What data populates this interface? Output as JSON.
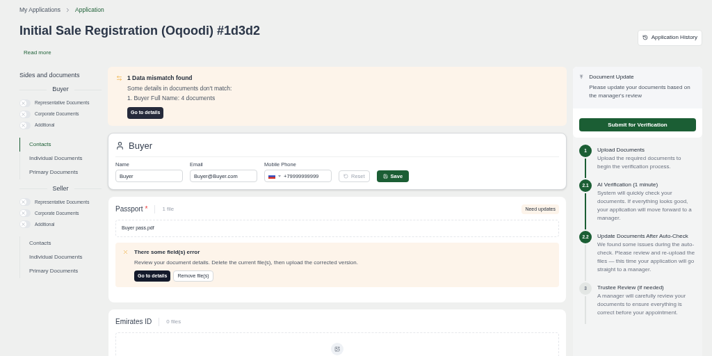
{
  "breadcrumb": [
    {
      "label": "My Applications",
      "selected": false
    },
    {
      "label": "Application",
      "selected": true
    }
  ],
  "title": "Initial Sale Registration (Oqoodi) #1d3d2",
  "read_more": "Read more",
  "history_button": "Application History",
  "sidebar": {
    "title": "Sides and documents",
    "sides": [
      {
        "name": "Buyer",
        "toggles": [
          {
            "label": "Representative Documents",
            "on": false
          },
          {
            "label": "Corporate Documents",
            "on": false
          },
          {
            "label": "Additional",
            "on": false
          }
        ],
        "items": [
          {
            "label": "Contacts",
            "selected": true
          },
          {
            "label": "Individual Documents",
            "selected": false
          },
          {
            "label": "Primary Documents",
            "selected": false
          }
        ]
      },
      {
        "name": "Seller",
        "toggles": [
          {
            "label": "Representative Documents",
            "on": false
          },
          {
            "label": "Corporate Documents",
            "on": false
          },
          {
            "label": "Additional",
            "on": false
          }
        ],
        "items": [
          {
            "label": "Contacts",
            "selected": false
          },
          {
            "label": "Individual Documents",
            "selected": false
          },
          {
            "label": "Primary Documents",
            "selected": false
          }
        ]
      }
    ]
  },
  "mismatch": {
    "title": "1 Data mismatch found",
    "lines": [
      "Some details in documents don't match:",
      "1. Buyer Full Name: 4 documents"
    ],
    "button": "Go to details"
  },
  "contact": {
    "title": "Buyer",
    "fields": [
      {
        "label": "Name",
        "value": "Buyer"
      },
      {
        "label": "Email",
        "value": "Buyer@Buyer.com"
      }
    ],
    "phone": {
      "label": "Mobile Phone",
      "value": "+79999999999"
    },
    "reset": "Reset",
    "save": "Save"
  },
  "documents": [
    {
      "title": "Passport",
      "required_mark": "*",
      "count": "1 file",
      "badge": "Need updates",
      "files": [
        "Buyer pass.pdf"
      ],
      "error": {
        "title": "There some field(s) error",
        "text": "Review your document details. Delete the current file(s), then upload the corrected version.",
        "primary": "Go to details",
        "secondary": "Remove file(s)"
      }
    },
    {
      "title": "Emirates ID",
      "count": "0 files"
    }
  ],
  "update": {
    "title": "Document Update",
    "text": "Please update your documents based on the manager's review",
    "button": "Submit for Verification"
  },
  "steps": [
    {
      "number": "1",
      "title": "Upload Documents",
      "text": "Upload the required documents to begin the verification process.",
      "kind": "done"
    },
    {
      "number": "2.1",
      "title": "AI Verification (1 minute)",
      "text": "System will quickly check your documents. If everything looks good, your application will move forward to a manager.",
      "kind": "done"
    },
    {
      "number": "2.2",
      "title": "Update Documents After Auto-Check",
      "text": "We found some issues during the auto-check. Please review and re-upload the files — this time your application will go straight to a manager.",
      "kind": "current"
    },
    {
      "number": "3",
      "title": "Trustee Review (if needed)",
      "text": "A manager will carefully review your documents to ensure everything is correct before your appointment.",
      "kind": "pending"
    }
  ]
}
